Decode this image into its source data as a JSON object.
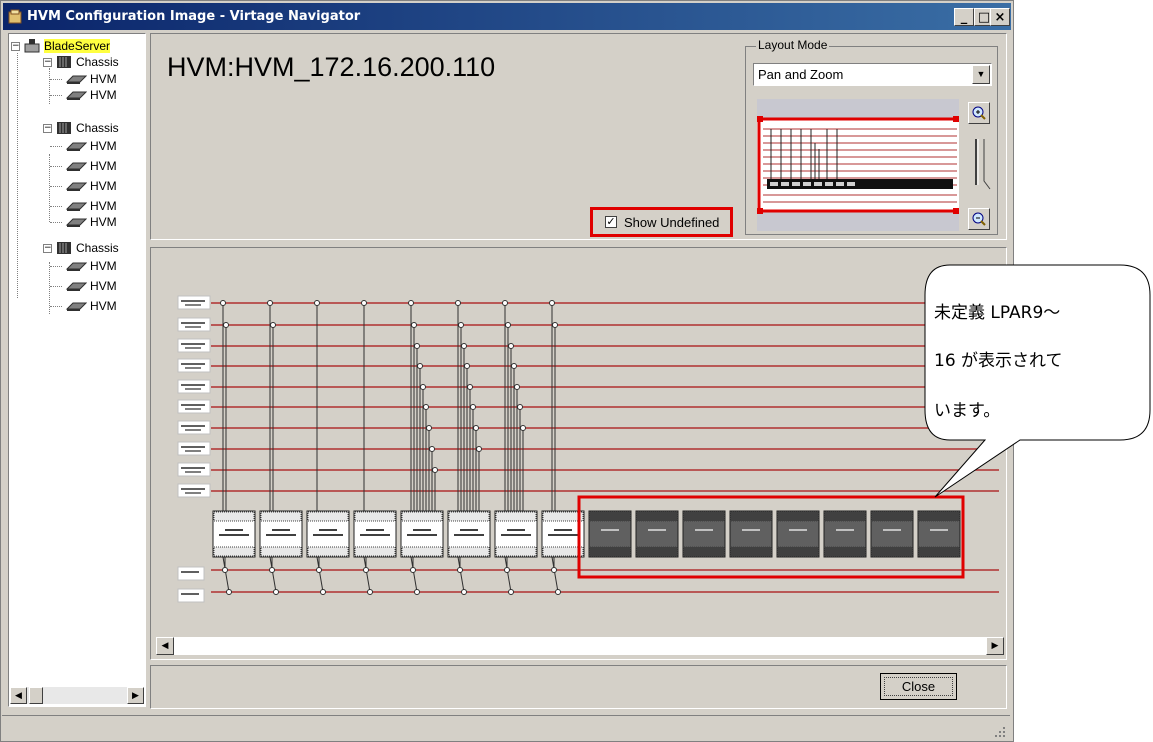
{
  "window": {
    "title": "HVM Configuration Image - Virtage Navigator",
    "minimize_label": "_",
    "maximize_label": "□",
    "close_label": "×"
  },
  "tree": {
    "root_label": "BladeServer",
    "chassis_label": "Chassis",
    "hvm_label": "HVM",
    "chassis_groups": [
      {
        "label": "Chassis",
        "children": [
          "HVM",
          "HVM"
        ]
      },
      {
        "label": "Chassis",
        "children": [
          "HVM",
          "HVM",
          "HVM",
          "HVM",
          "HVM"
        ]
      },
      {
        "label": "Chassis",
        "children": [
          "HVM",
          "HVM",
          "HVM"
        ]
      }
    ]
  },
  "header": {
    "hvm_title": "HVM:HVM_172.16.200.110",
    "show_undefined_label": "Show Undefined",
    "show_undefined_checked": true
  },
  "layout_mode": {
    "legend": "Layout Mode",
    "selected": "Pan and Zoom"
  },
  "diagram": {
    "defined_lpar_count": 8,
    "undefined_lpar_count": 8,
    "highlight_color": "#e00000",
    "line_color": "#b03030",
    "defined_color": "#ffffff",
    "undefined_color": "#606060"
  },
  "buttons": {
    "close_label": "Close"
  },
  "callout": {
    "line1": "未定義 LPAR9～",
    "line2": "16 が表示されて",
    "line3": "います。"
  }
}
